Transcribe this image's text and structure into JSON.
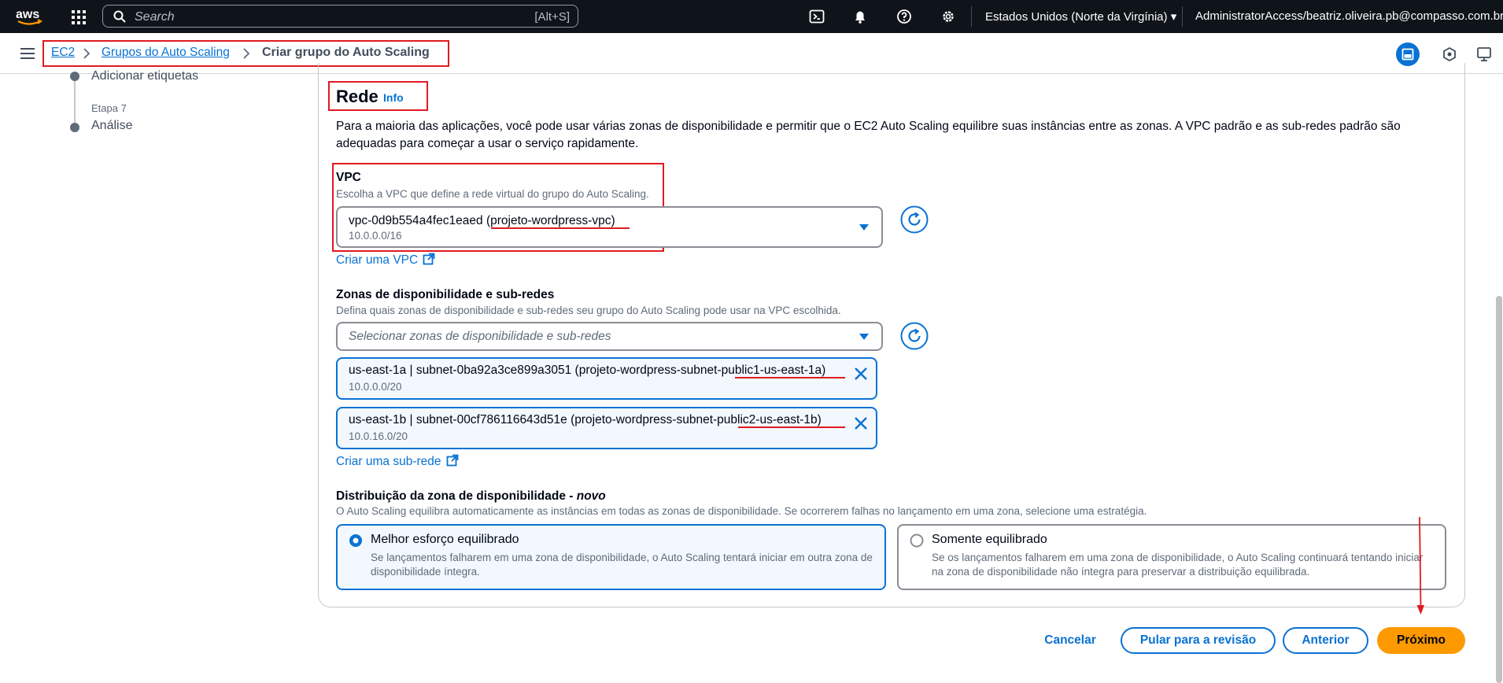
{
  "topbar": {
    "search_placeholder": "Search",
    "search_shortcut": "[Alt+S]",
    "region": "Estados Unidos (Norte da Virgínia)",
    "account": "AdministratorAccess/beatriz.oliveira.pb@compasso.com.br",
    "icons": [
      "aws-logo-icon",
      "apps-grid-icon",
      "search-icon",
      "cloudshell-icon",
      "bell-icon",
      "help-icon",
      "gear-icon"
    ]
  },
  "breadcrumb": {
    "items": [
      "EC2",
      "Grupos do Auto Scaling",
      "Criar grupo do Auto Scaling"
    ]
  },
  "steps": {
    "prev_step": "Adicionar etiquetas",
    "step7_label": "Etapa 7",
    "step7_title": "Análise"
  },
  "network": {
    "title": "Rede",
    "info": "Info",
    "description": "Para a maioria das aplicações, você pode usar várias zonas de disponibilidade e permitir que o EC2 Auto Scaling equilibre suas instâncias entre as zonas. A VPC padrão e as sub-redes padrão são adequadas para começar a usar o serviço rapidamente.",
    "vpc": {
      "label": "VPC",
      "description": "Escolha a VPC que define a rede virtual do grupo do Auto Scaling.",
      "value": "vpc-0d9b554a4fec1eaed (projeto-wordpress-vpc)",
      "cidr": "10.0.0.0/16",
      "create_link": "Criar uma VPC"
    },
    "zones": {
      "label": "Zonas de disponibilidade e sub-redes",
      "description": "Defina quais zonas de disponibilidade e sub-redes seu grupo do Auto Scaling pode usar na VPC escolhida.",
      "placeholder": "Selecionar zonas de disponibilidade e sub-redes",
      "selected": [
        {
          "value": "us-east-1a | subnet-0ba92a3ce899a3051 (projeto-wordpress-subnet-public1-us-east-1a)",
          "cidr": "10.0.0.0/20"
        },
        {
          "value": "us-east-1b | subnet-00cf786116643d51e (projeto-wordpress-subnet-public2-us-east-1b)",
          "cidr": "10.0.16.0/20"
        }
      ],
      "create_link": "Criar uma sub-rede"
    },
    "distribution": {
      "label": "Distribuição da zona de disponibilidade - ",
      "label_new": "novo",
      "description": "O Auto Scaling equilibra automaticamente as instâncias em todas as zonas de disponibilidade. Se ocorrerem falhas no lançamento em uma zona, selecione uma estratégia.",
      "options": [
        {
          "title": "Melhor esforço equilibrado",
          "desc": "Se lançamentos falharem em uma zona de disponibilidade, o Auto Scaling tentará iniciar em outra zona de disponibilidade íntegra.",
          "selected": true
        },
        {
          "title": "Somente equilibrado",
          "desc": "Se os lançamentos falharem em uma zona de disponibilidade, o Auto Scaling continuará tentando iniciar na zona de disponibilidade não íntegra para preservar a distribuição equilibrada.",
          "selected": false
        }
      ]
    }
  },
  "footer": {
    "cancel": "Cancelar",
    "skip": "Pular para a revisão",
    "previous": "Anterior",
    "next": "Próximo"
  },
  "colors": {
    "topbar_bg": "#0f141a",
    "link": "#0972d3",
    "primary": "#ff9900",
    "annotation_red": "#e01a22"
  }
}
